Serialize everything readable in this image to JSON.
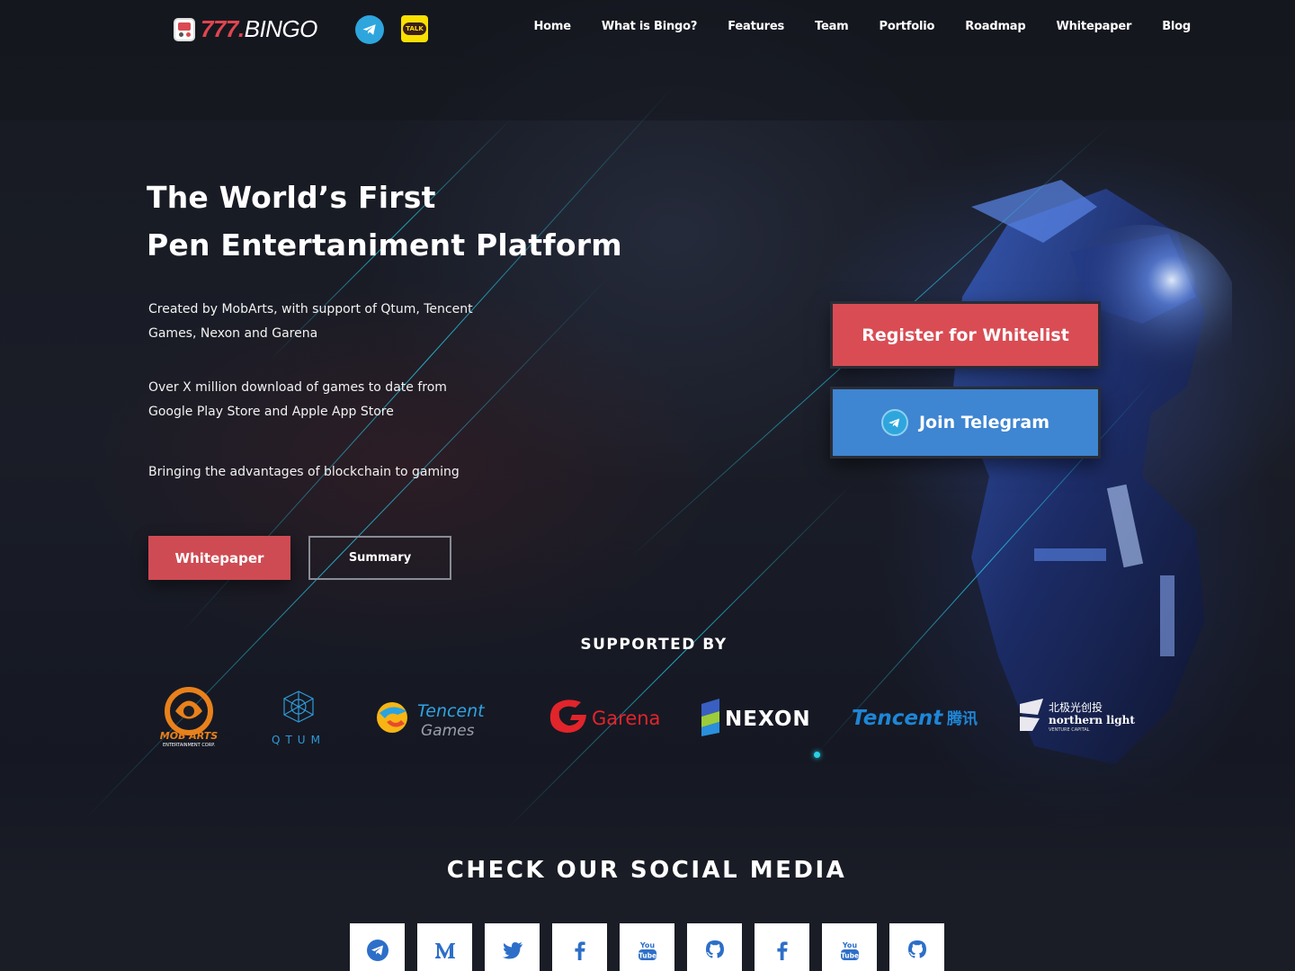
{
  "header": {
    "logo_number": "777.",
    "logo_word": "BINGO",
    "icons": [
      "telegram-icon",
      "kakaotalk-icon"
    ],
    "kakao_label": "TALK",
    "nav": [
      "Home",
      "What is Bingo?",
      "Features",
      "Team",
      "Portfolio",
      "Roadmap",
      "Whitepaper",
      "Blog"
    ]
  },
  "hero": {
    "title_line1": "The World’s First",
    "title_line2": "Pen Entertaniment Platform",
    "paragraph1": "Created by MobArts, with support of Qtum, Tencent Games, Nexon and Garena",
    "paragraph2": "Over X million download of games to date from Google Play Store and Apple App Store",
    "paragraph3": "Bringing the advantages of blockchain to gaming",
    "whitepaper_button": "Whitepaper",
    "summary_button": "Summary",
    "register_button": "Register for Whitelist",
    "telegram_button": "Join Telegram"
  },
  "supported": {
    "title": "SUPPORTED BY",
    "partners": [
      {
        "name": "MOB ARTS",
        "sub": "ENTERTAINMENT CORP."
      },
      {
        "name": "QTUM"
      },
      {
        "name": "Tencent",
        "sub": "Games"
      },
      {
        "name": "Garena"
      },
      {
        "name": "NEXON"
      },
      {
        "name": "Tencent",
        "sub": "腾讯"
      },
      {
        "name": "northern light",
        "cn": "北极光创投",
        "sub": "VENTURE CAPITAL"
      }
    ]
  },
  "social": {
    "title": "CHECK OUR SOCIAL MEDIA",
    "icons": [
      "telegram-icon",
      "medium-icon",
      "twitter-icon",
      "facebook-icon",
      "youtube-icon",
      "github-icon",
      "facebook-icon",
      "youtube-icon",
      "github-icon"
    ]
  },
  "colors": {
    "accent_red": "#cf4b53",
    "telegram_blue": "#3e85d2",
    "streak_cyan": "#2ad0e6",
    "background": "#171a22"
  }
}
